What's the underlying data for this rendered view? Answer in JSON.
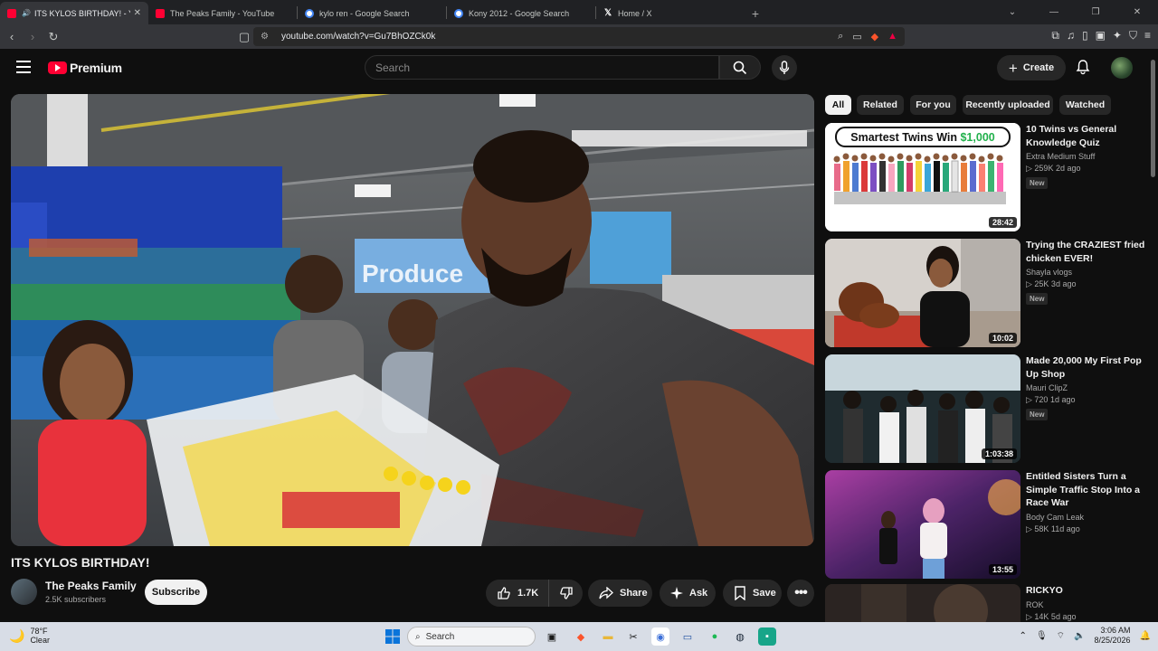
{
  "browser": {
    "tabs": [
      {
        "title": "ITS KYLOS BIRTHDAY! - YouTu",
        "favicon": "youtube-icon",
        "active": true
      },
      {
        "title": "The Peaks Family - YouTube",
        "favicon": "youtube-icon",
        "active": false
      },
      {
        "title": "kylo ren - Google Search",
        "favicon": "google-icon",
        "active": false
      },
      {
        "title": "Kony 2012 - Google Search",
        "favicon": "google-icon",
        "active": false
      },
      {
        "title": "Home / X",
        "favicon": "x-icon",
        "active": false
      }
    ],
    "url": "youtube.com/watch?v=Gu7BhOZCk0k"
  },
  "header": {
    "brand": "Premium",
    "search_placeholder": "Search",
    "create_label": "Create"
  },
  "video": {
    "title": "ITS KYLOS BIRTHDAY!",
    "channel_name": "The Peaks Family",
    "subscribers": "2.5K subscribers",
    "subscribe_label": "Subscribe",
    "likes": "1.7K",
    "share_label": "Share",
    "ask_label": "Ask",
    "save_label": "Save"
  },
  "chips": [
    "All",
    "Related",
    "For you",
    "Recently uploaded",
    "Watched"
  ],
  "recommendations": [
    {
      "title": "10 Twins vs General Knowledge Quiz",
      "channel": "Extra Medium Stuff",
      "meta": "▷ 259K  2d ago",
      "badge": "New",
      "duration": "28:42",
      "thumb_text": "Smartest Twins Win",
      "thumb_amount": "$1,000"
    },
    {
      "title": "Trying the CRAZIEST fried chicken EVER!",
      "channel": "Shayla vlogs",
      "meta": "▷ 25K  3d ago",
      "badge": "New",
      "duration": "10:02"
    },
    {
      "title": "Made 20,000 My First Pop Up Shop",
      "channel": "Mauri ClipZ",
      "meta": "▷ 720  1d ago",
      "badge": "New",
      "duration": "1:03:38"
    },
    {
      "title": "Entitled Sisters Turn a Simple Traffic Stop Into a Race War",
      "channel": "Body Cam Leak",
      "meta": "▷ 58K  11d ago",
      "badge": "",
      "duration": "13:55"
    },
    {
      "title": "RICKYO",
      "channel": "ROK",
      "meta": "▷ 14K  5d ago",
      "badge": "",
      "duration": ""
    }
  ],
  "taskbar": {
    "temperature": "78°F",
    "condition": "Clear",
    "search_label": "Search",
    "time": "3:06 AM",
    "date": "8/25/2026"
  }
}
